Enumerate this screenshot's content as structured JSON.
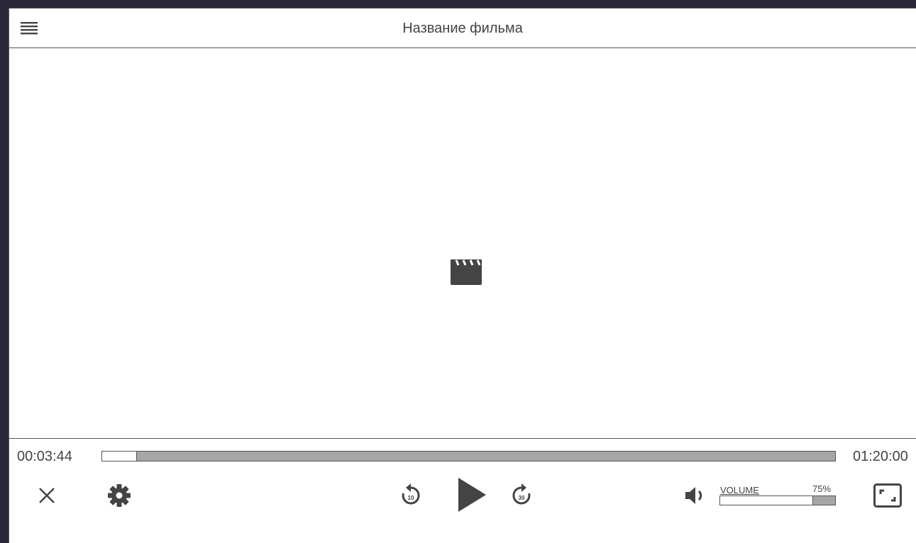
{
  "header": {
    "title": "Название фильма",
    "menu_icon": "hamburger-menu-icon"
  },
  "video": {
    "placeholder_icon": "film-clapperboard-icon"
  },
  "playback": {
    "current_time": "00:03:44",
    "total_time": "01:20:00",
    "progress_fraction": 0.0467
  },
  "controls": {
    "close_icon": "close-icon",
    "settings_icon": "gear-icon",
    "rewind_icon": "rewind-10-icon",
    "rewind_label": "10",
    "play_icon": "play-icon",
    "forward_icon": "forward-30-icon",
    "forward_label": "30",
    "volume_icon": "volume-icon",
    "fullscreen_icon": "fullscreen-icon"
  },
  "volume": {
    "label": "VOLUME",
    "percent_text": "75%",
    "level": 0.8
  },
  "colors": {
    "icon": "#444444",
    "track": "#a6a6a6",
    "background": "#2a2838"
  }
}
